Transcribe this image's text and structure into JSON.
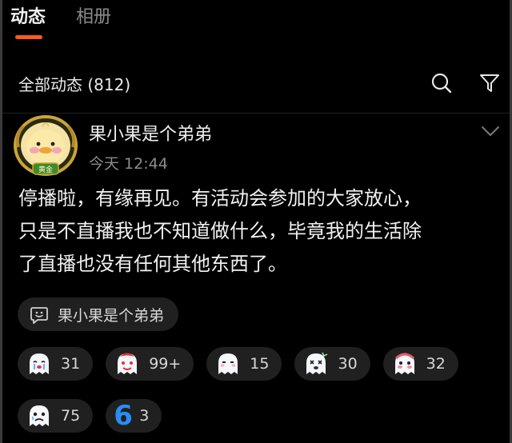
{
  "tabs": [
    {
      "label": "动态",
      "active": true
    },
    {
      "label": "相册",
      "active": false
    }
  ],
  "filter": {
    "title": "全部动态 (812)"
  },
  "post": {
    "author": "果小果是个弟弟",
    "time": "今天 12:44",
    "badge": "黄金",
    "text_lines": [
      "停播啦，有缘再见。有活动会参加的大家放心，",
      "只是不直播我也不知道做什么，毕竟我的生活除",
      "了直播也没有任何其他东西了。"
    ],
    "topic": "果小果是个弟弟"
  },
  "reactions": [
    {
      "icon": "crying-ghost-icon",
      "count": "31"
    },
    {
      "icon": "red-ghost-icon",
      "count": "99+"
    },
    {
      "icon": "ghost-icon",
      "count": "15"
    },
    {
      "icon": "dizzy-ghost-icon",
      "count": "30"
    },
    {
      "icon": "pink-ghost-icon",
      "count": "32"
    },
    {
      "icon": "sad-ghost-icon",
      "count": "75"
    },
    {
      "icon": "six-icon",
      "count": "3"
    }
  ],
  "colors": {
    "accent": "#ff5a1f",
    "chip_bg": "#202020",
    "six_blue": "#2a8df4"
  }
}
